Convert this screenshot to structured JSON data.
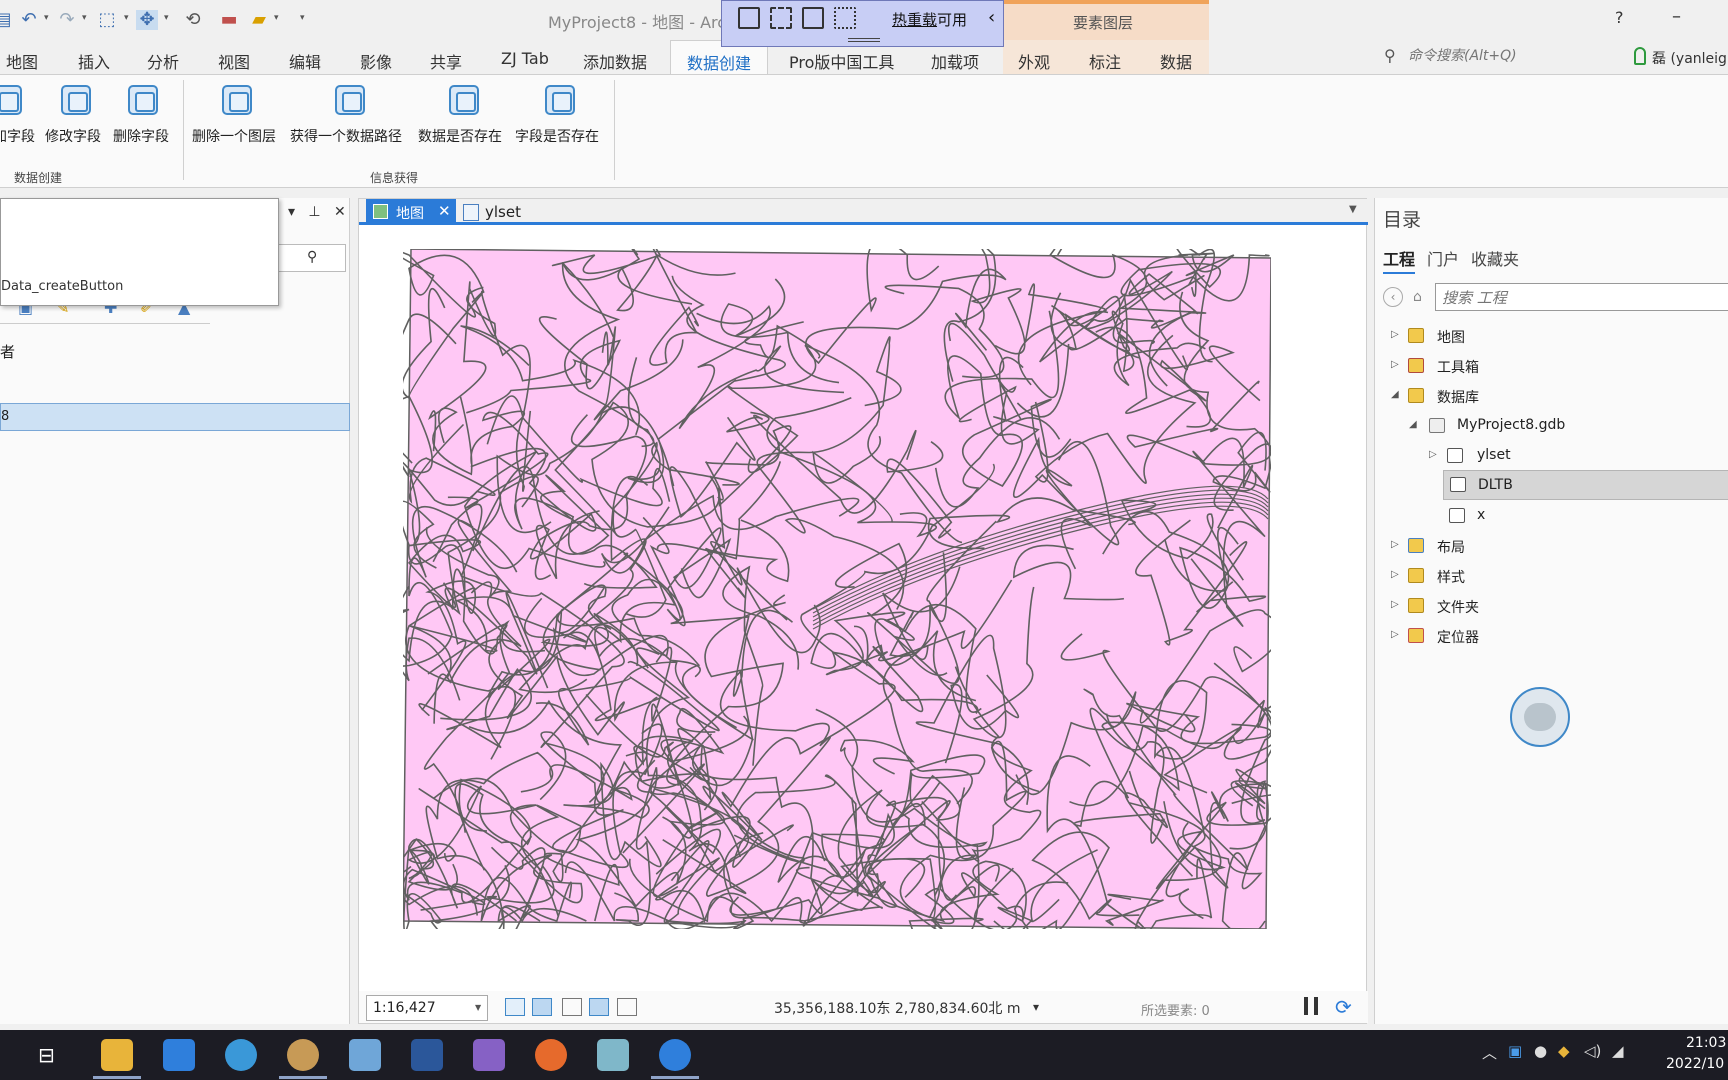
{
  "window": {
    "title": "MyProject8 - 地图 - ArcG",
    "context_tab_title": "要素图层",
    "help": "?",
    "minimize": "–"
  },
  "hot_reload": {
    "text_part1": "热重载",
    "text_part2": "可用",
    "collapse": "‹"
  },
  "ribbon": {
    "tabs": [
      "地图",
      "插入",
      "分析",
      "视图",
      "编辑",
      "影像",
      "共享",
      "ZJ Tab",
      "添加数据",
      "数据创建",
      "Pro版中国工具",
      "加载项",
      "外观",
      "标注",
      "数据"
    ],
    "active_tab": "数据创建",
    "command_search_placeholder": "命令搜索(Alt+Q)",
    "user": "磊 (yanleig",
    "groups": [
      {
        "label": "数据创建",
        "buttons": [
          "加字段",
          "修改字段",
          "删除字段"
        ]
      },
      {
        "label": "信息获得",
        "buttons": [
          "删除一个图层",
          "获得一个数据路径",
          "数据是否存在",
          "字段是否存在"
        ]
      }
    ]
  },
  "left_pane": {
    "tooltip_text": "Data_createButton",
    "heading": "者",
    "selected_item": "8"
  },
  "map_view": {
    "tabs": [
      {
        "label": "地图",
        "active": true
      },
      {
        "label": "ylset",
        "active": false
      }
    ],
    "fill_color": "#ffc8f5",
    "outline_color": "#606060",
    "scale": "1:16,427",
    "coordinates": "35,356,188.10东 2,780,834.60北 m",
    "selected_features": "所选要素: 0"
  },
  "catalog": {
    "title": "目录",
    "tabs": [
      "工程",
      "门户",
      "收藏夹"
    ],
    "active_tab": "工程",
    "search_placeholder": "搜索 工程",
    "tree": [
      {
        "label": "地图",
        "expanded": false,
        "icon": "map-folder-icon"
      },
      {
        "label": "工具箱",
        "expanded": false,
        "icon": "toolbox-folder-icon"
      },
      {
        "label": "数据库",
        "expanded": true,
        "icon": "database-folder-icon"
      },
      {
        "label": "MyProject8.gdb",
        "expanded": true,
        "icon": "geodatabase-icon"
      },
      {
        "label": "ylset",
        "expanded": false,
        "icon": "feature-dataset-icon"
      },
      {
        "label": "DLTB",
        "selected": true,
        "icon": "feature-class-icon"
      },
      {
        "label": "x",
        "icon": "feature-class-icon"
      },
      {
        "label": "布局",
        "expanded": false,
        "icon": "layout-folder-icon"
      },
      {
        "label": "样式",
        "expanded": false,
        "icon": "style-folder-icon"
      },
      {
        "label": "文件夹",
        "expanded": false,
        "icon": "folder-icon"
      },
      {
        "label": "定位器",
        "expanded": false,
        "icon": "locator-folder-icon"
      }
    ]
  },
  "taskbar": {
    "time": "21:03",
    "date": "2022/10"
  }
}
